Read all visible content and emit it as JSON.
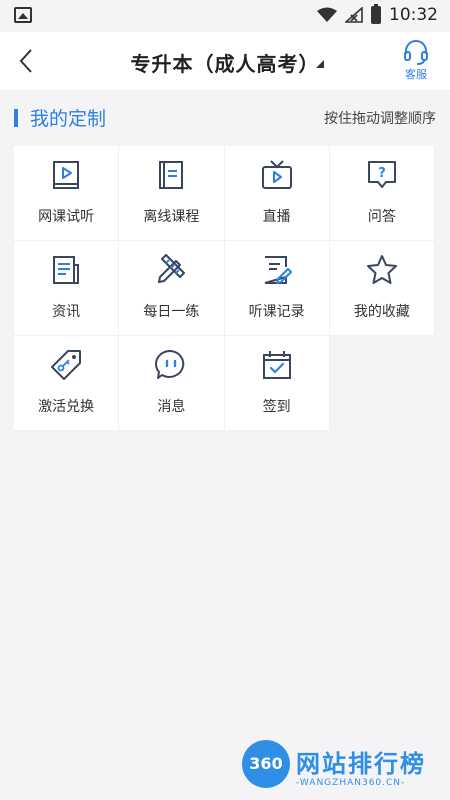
{
  "status_bar": {
    "time": "10:32"
  },
  "header": {
    "title": "专升本（成人高考）",
    "service_label": "客服"
  },
  "section": {
    "title": "我的定制",
    "hint": "按住拖动调整顺序"
  },
  "grid_items": [
    {
      "label": "网课试听",
      "icon": "video-book-icon"
    },
    {
      "label": "离线课程",
      "icon": "book-icon"
    },
    {
      "label": "直播",
      "icon": "tv-icon"
    },
    {
      "label": "问答",
      "icon": "question-icon"
    },
    {
      "label": "资讯",
      "icon": "news-icon"
    },
    {
      "label": "每日一练",
      "icon": "pencil-ruler-icon"
    },
    {
      "label": "听课记录",
      "icon": "edit-doc-icon"
    },
    {
      "label": "我的收藏",
      "icon": "star-icon"
    },
    {
      "label": "激活兑换",
      "icon": "tag-key-icon"
    },
    {
      "label": "消息",
      "icon": "message-icon"
    },
    {
      "label": "签到",
      "icon": "calendar-check-icon"
    }
  ],
  "watermark": {
    "badge": "360",
    "name": "网站排行榜",
    "url": "-WANGZHAN360.CN-"
  },
  "colors": {
    "accent": "#2f7fe0",
    "icon": "#3a4560"
  }
}
